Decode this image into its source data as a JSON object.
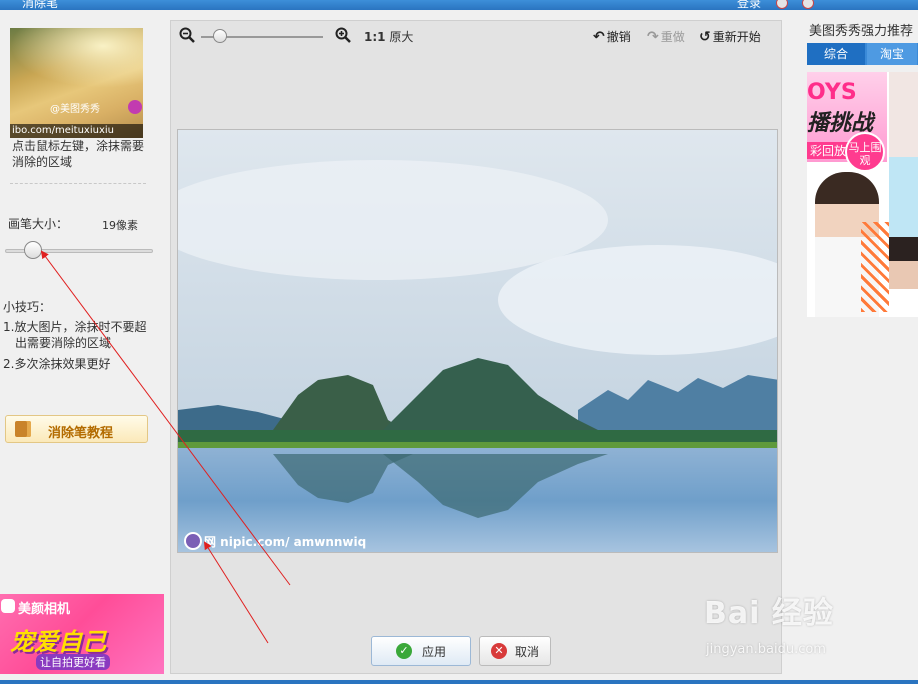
{
  "window": {
    "title": "消除笔",
    "login": "登录"
  },
  "left_panel": {
    "thumbnail": {
      "watermark": "@美图秀秀",
      "url": "ibo.com/meituxiuxiu"
    },
    "hint": "点击鼠标左键，涂抹需要消除的区域",
    "brush": {
      "label": "画笔大小：",
      "value": "19像素",
      "slider_fraction": 0.19
    },
    "tips": {
      "title": "小技巧：",
      "items": [
        "1.放大图片，涂抹时不要超",
        "出需要消除的区域",
        "2.多次涂抹效果更好"
      ]
    },
    "tutorial_button": "消除笔教程",
    "ad": {
      "brand": "美颜相机",
      "slogan": "宠爱自己",
      "sub": "让自拍更好看"
    }
  },
  "editor": {
    "toolbar": {
      "ratio_bold": "1:1",
      "ratio_text": "原大",
      "undo": "撤销",
      "redo": "重做",
      "restart": "重新开始"
    },
    "photo_watermark": "网 nipic.com/ amwnnwiq",
    "apply": "应用",
    "cancel": "取消"
  },
  "right_panel": {
    "title": "美图秀秀强力推荐",
    "tabs": [
      "综合",
      "淘宝"
    ],
    "ad": {
      "big1": "OYS",
      "big2": "播挑战",
      "replay": "彩回放",
      "badge": "马上围观"
    }
  },
  "overlay": {
    "baidu": "Bai 经验",
    "baidu_sub": "jingyan.baidu.com"
  },
  "colors": {
    "accent": "#2a74c0",
    "arrow": "#e02020"
  }
}
